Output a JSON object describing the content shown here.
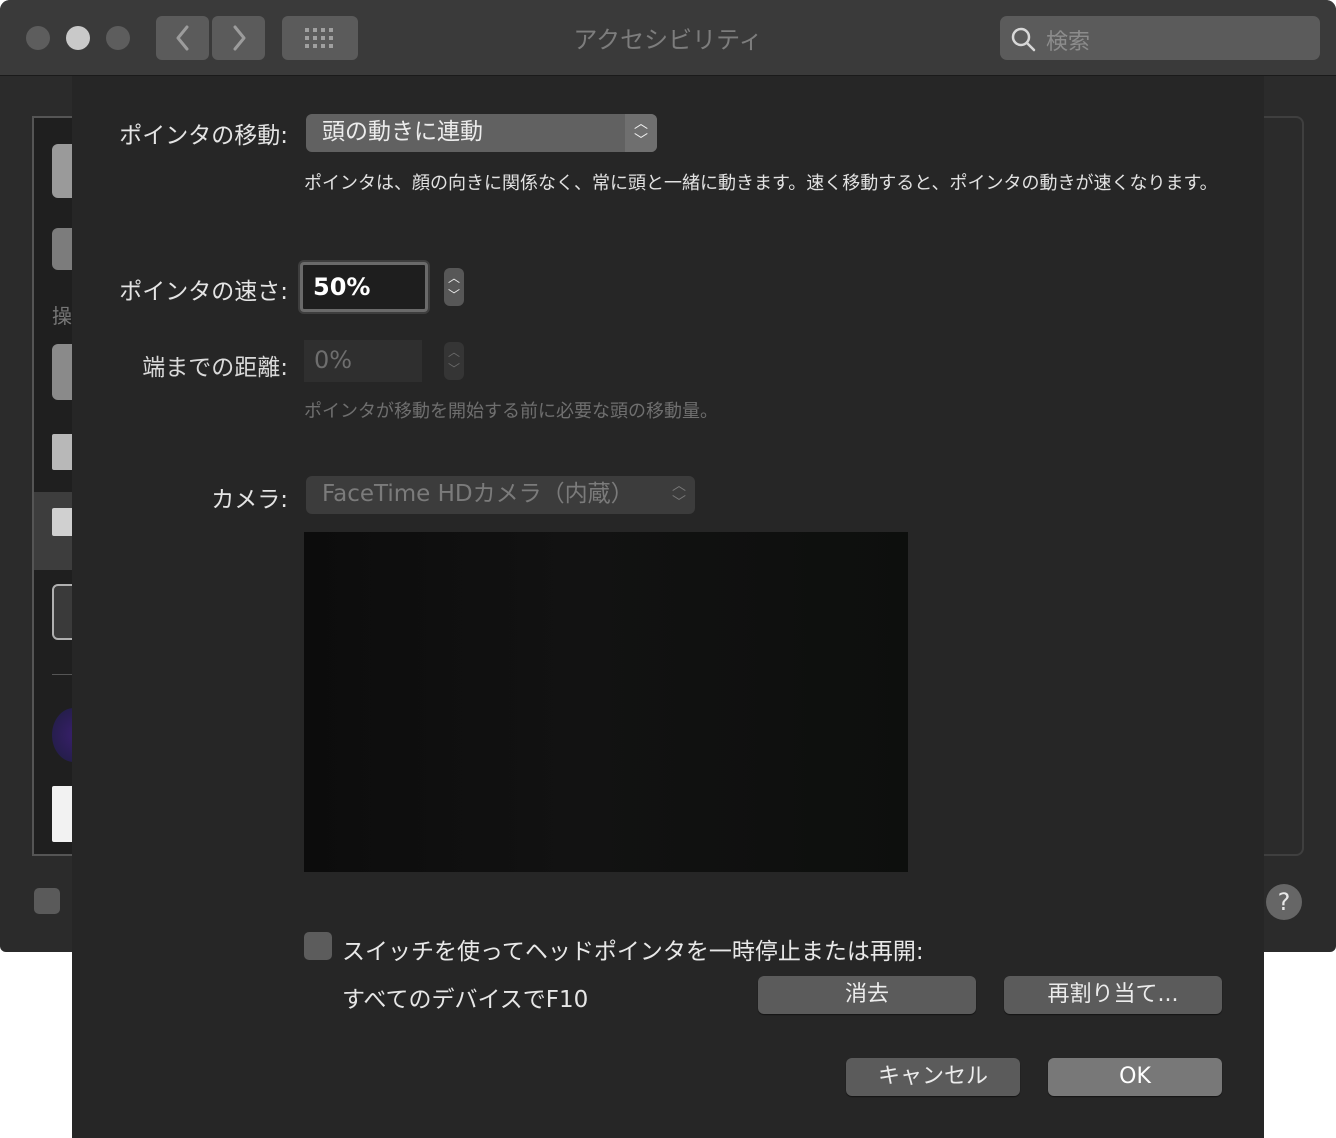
{
  "window": {
    "title": "アクセシビリティ",
    "search_placeholder": "検索",
    "nav_back": "‹",
    "nav_forward": "›",
    "grid_icon": "grid-icon",
    "sidebar_partial_text": "操",
    "help_label": "?"
  },
  "sheet": {
    "pointer_move": {
      "label": "ポインタの移動:",
      "value": "頭の動きに連動",
      "description": "ポインタは、顔の向きに関係なく、常に頭と一緒に動きます。速く移動すると、ポインタの動きが速くなります。"
    },
    "pointer_speed": {
      "label": "ポインタの速さ:",
      "value": "50%"
    },
    "edge_distance": {
      "label": "端までの距離:",
      "value": "0%",
      "description": "ポインタが移動を開始する前に必要な頭の移動量。"
    },
    "camera": {
      "label": "カメラ:",
      "value": "FaceTime HDカメラ（内蔵）"
    },
    "switch_pause": {
      "label": "スイッチを使ってヘッドポインタを一時停止または再開:",
      "checked": false,
      "assignment": "すべてのデバイスでF10",
      "clear_label": "消去",
      "reassign_label": "再割り当て..."
    },
    "cancel_label": "キャンセル",
    "ok_label": "OK"
  }
}
